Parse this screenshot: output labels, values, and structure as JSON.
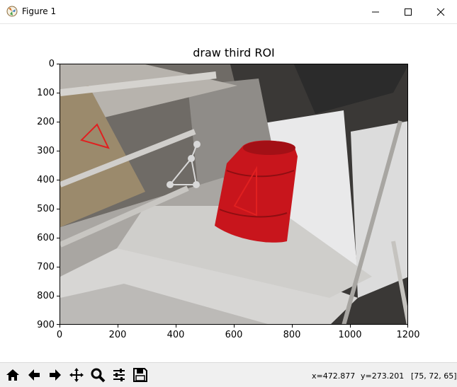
{
  "window": {
    "title": "Figure 1",
    "minimize_label": "minimize",
    "maximize_label": "maximize",
    "close_label": "close"
  },
  "plot": {
    "title": "draw third ROI",
    "y_ticks": [
      "0",
      "100",
      "200",
      "300",
      "400",
      "500",
      "600",
      "700",
      "800",
      "900"
    ],
    "x_ticks": [
      "0",
      "200",
      "400",
      "600",
      "800",
      "1000",
      "1200"
    ]
  },
  "toolbar": {
    "tools": [
      "home-icon",
      "back-icon",
      "forward-icon",
      "pan-icon",
      "zoom-icon",
      "configure-subplots-icon",
      "save-icon"
    ]
  },
  "status": {
    "x": "x=472.877",
    "y": "y=273.201",
    "rgb": "[75, 72, 65]"
  },
  "colors": {
    "roi": "#e02020",
    "roi_draft": "#d8d8d8",
    "barrel": "#c8151c"
  }
}
